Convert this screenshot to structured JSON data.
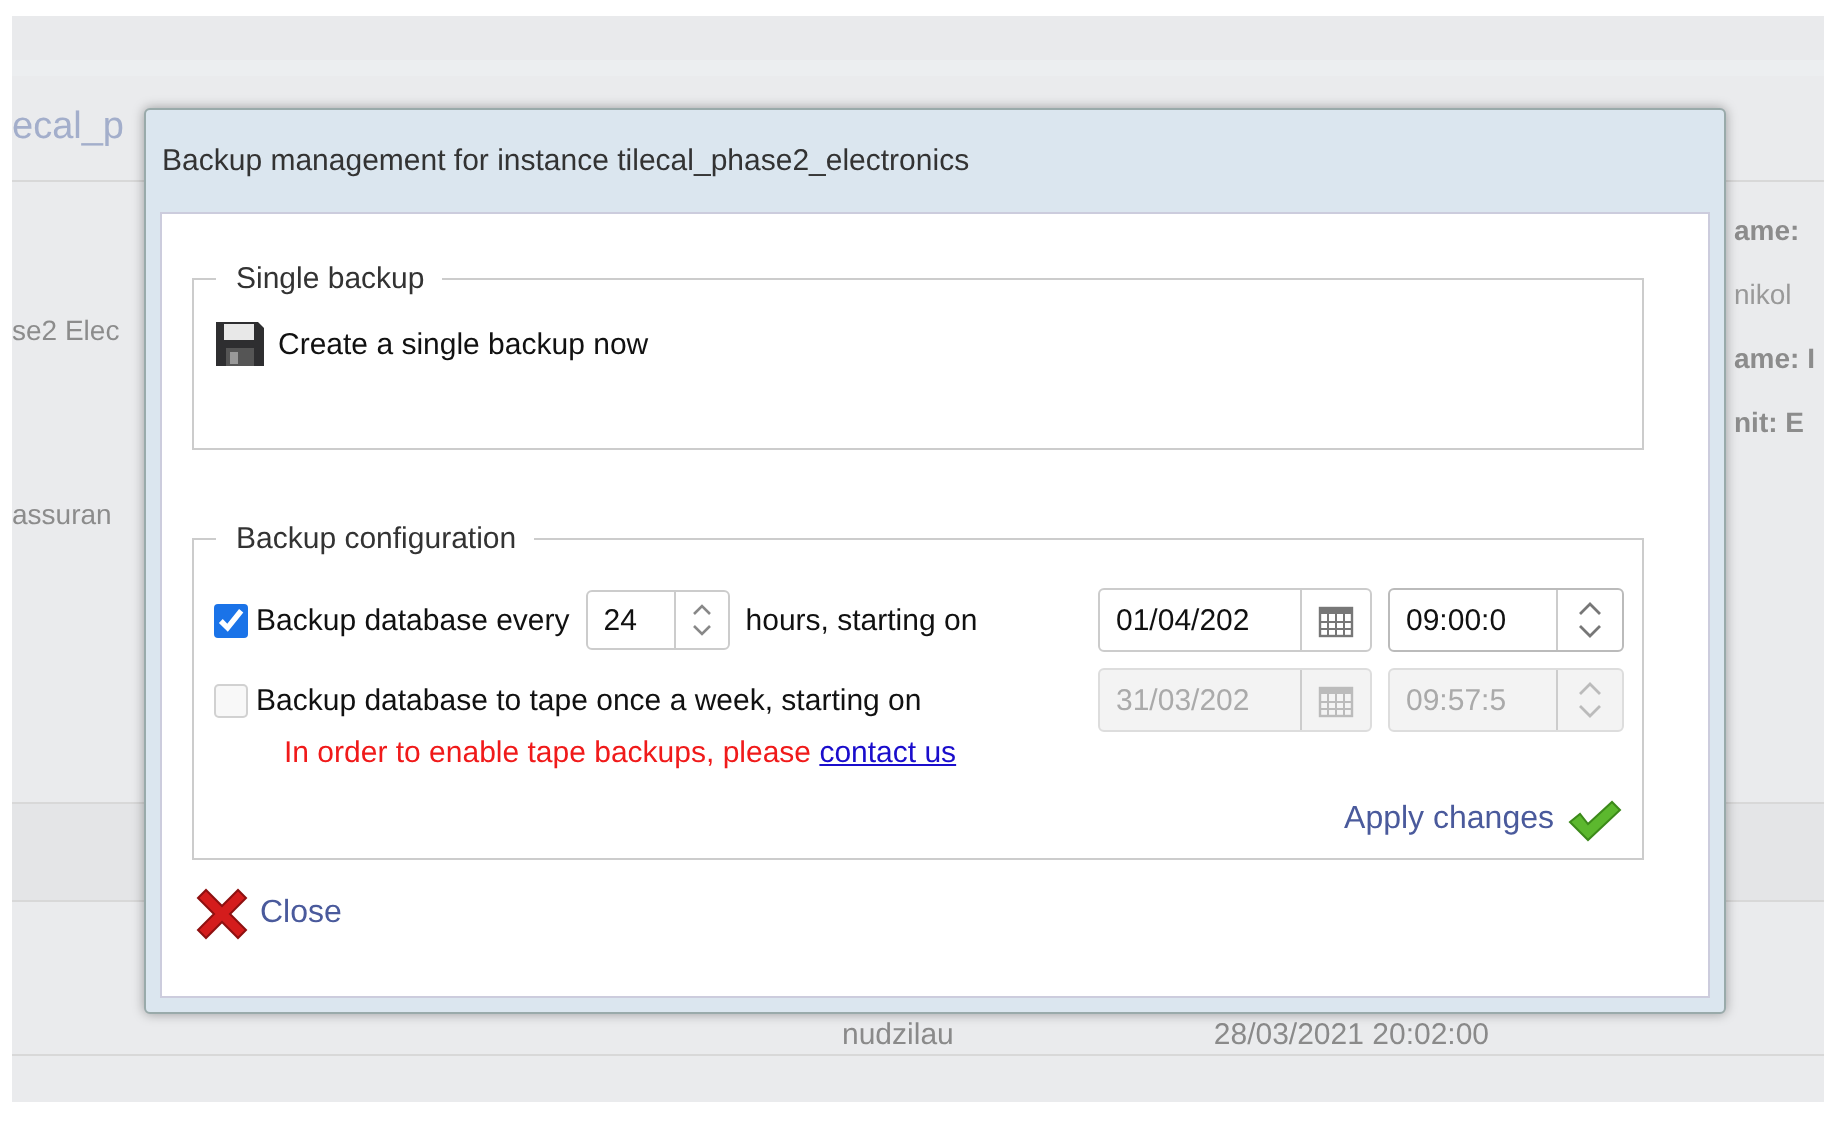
{
  "background": {
    "title": "ecal_p",
    "left_texts": [
      "se2 Elec",
      "assuran"
    ],
    "right_fields": [
      {
        "text": "ame:",
        "bold": true
      },
      {
        "text": "nikol",
        "bold": false
      },
      {
        "text": "ame: I",
        "bold": true
      },
      {
        "text": "nit: E",
        "bold": true
      }
    ],
    "row": {
      "user": "nudzilau",
      "date": "28/03/2021 20:02:00"
    }
  },
  "dialog": {
    "title": "Backup management for instance tilecal_phase2_electronics",
    "single_backup": {
      "legend": "Single backup",
      "action": "Create a single backup now"
    },
    "configuration": {
      "legend": "Backup configuration",
      "rows": [
        {
          "kind": "periodic",
          "checked": true,
          "disabled": false,
          "label": "Backup database every",
          "hours": "24",
          "after": "hours, starting on",
          "date": "01/04/202",
          "time": "09:00:0"
        },
        {
          "kind": "weekly",
          "checked": false,
          "disabled": true,
          "label": "Backup database to tape once a week, starting on",
          "date": "31/03/202",
          "time": "09:57:5"
        }
      ],
      "notice": {
        "text": "In order to enable tape backups, please",
        "link": "contact us"
      },
      "apply": "Apply changes"
    },
    "close": "Close"
  }
}
